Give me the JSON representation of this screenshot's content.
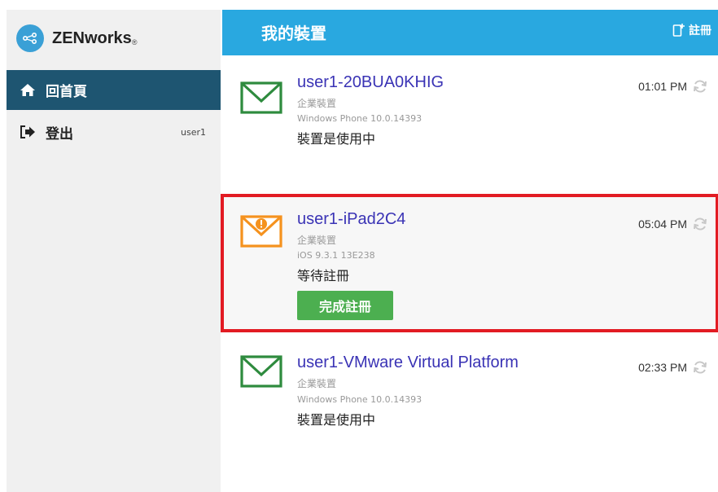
{
  "app": {
    "brand": "ZENworks",
    "brand_mark": "®"
  },
  "sidebar": {
    "items": [
      {
        "label": "回首頁",
        "icon": "home-icon"
      },
      {
        "label": "登出",
        "icon": "logout-icon",
        "user": "user1"
      }
    ]
  },
  "header": {
    "title": "我的裝置",
    "register_label": "註冊",
    "register_icon": "register-device-icon"
  },
  "devices": [
    {
      "name": "user1-20BUA0KHIG",
      "type": "企業裝置",
      "os": "Windows Phone 10.0.14393",
      "status": "裝置是使用中",
      "time": "01:01 PM",
      "icon": "envelope-icon"
    },
    {
      "name": "user1-iPad2C4",
      "type": "企業裝置",
      "os": "iOS 9.3.1 13E238",
      "status": "等待註冊",
      "time": "05:04 PM",
      "icon": "envelope-warning-icon",
      "action_label": "完成註冊"
    },
    {
      "name": "user1-VMware Virtual Platform",
      "type": "企業裝置",
      "os": "Windows Phone 10.0.14393",
      "status": "裝置是使用中",
      "time": "02:33 PM",
      "icon": "envelope-icon"
    }
  ],
  "colors": {
    "header": "#29a8e0",
    "nav_active": "#1e5571",
    "highlight": "#e21b23",
    "button": "#4caf50",
    "link": "#3a33b5",
    "envelope_ok": "#2e8b3e",
    "envelope_pending": "#f5921e"
  }
}
